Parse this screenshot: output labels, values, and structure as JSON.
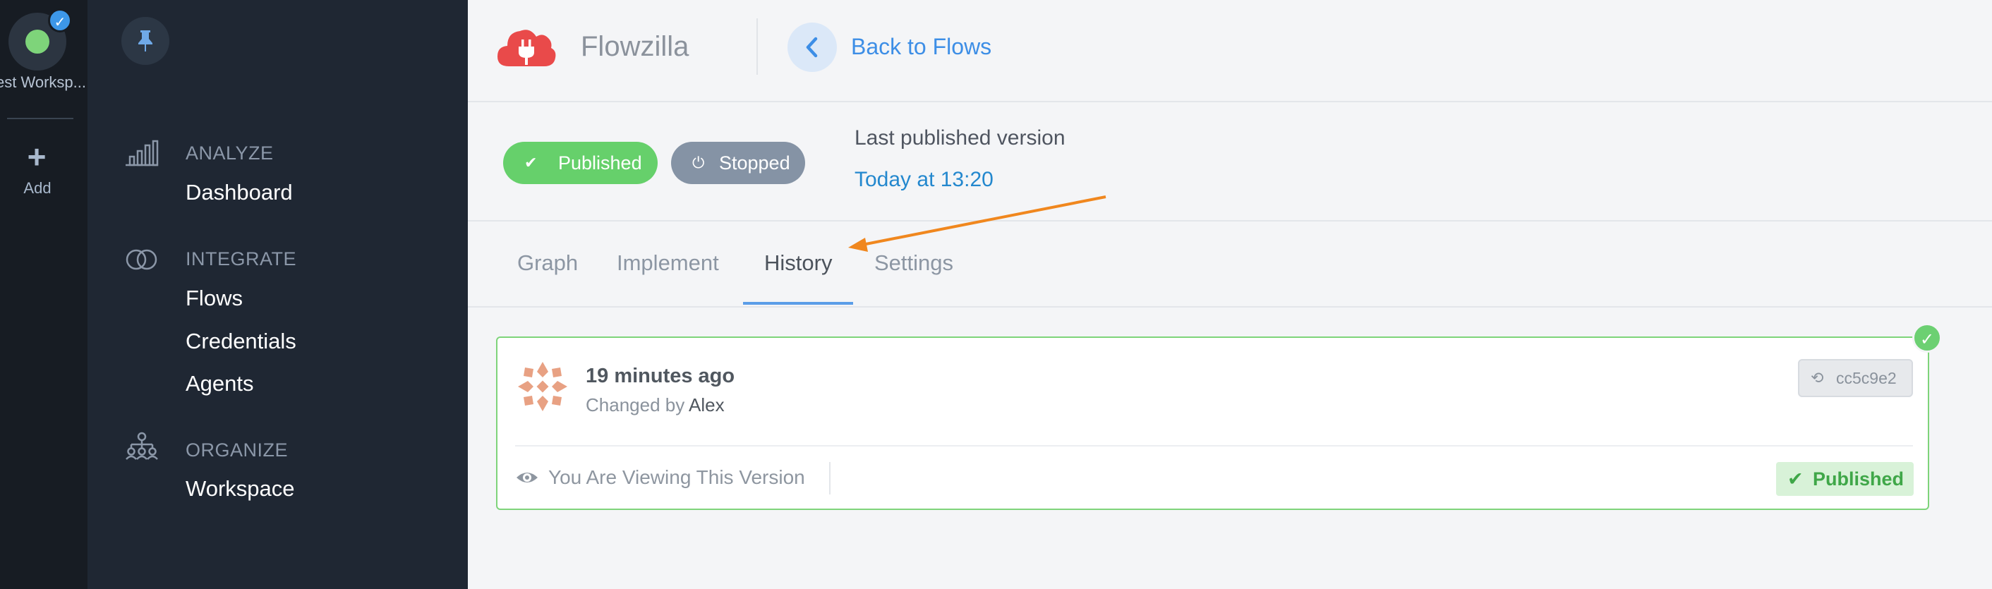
{
  "workspace": {
    "name": "est Worksp...",
    "add_label": "Add"
  },
  "nav": {
    "groups": [
      {
        "label": "ANALYZE",
        "items": [
          "Dashboard"
        ]
      },
      {
        "label": "INTEGRATE",
        "items": [
          "Flows",
          "Credentials",
          "Agents"
        ]
      },
      {
        "label": "ORGANIZE",
        "items": [
          "Workspace"
        ]
      }
    ]
  },
  "header": {
    "app_name": "Flowzilla",
    "back_label": "Back to Flows"
  },
  "status": {
    "published_label": "Published",
    "stopped_label": "Stopped",
    "last_published_label": "Last published version",
    "last_published_date": "Today at 13:20"
  },
  "tabs": [
    {
      "label": "Graph",
      "active": false
    },
    {
      "label": "Implement",
      "active": false
    },
    {
      "label": "History",
      "active": true
    },
    {
      "label": "Settings",
      "active": false
    }
  ],
  "history": {
    "time": "19 minutes ago",
    "changed_by_prefix": "Changed by",
    "author": "Alex",
    "commit": "cc5c9e2",
    "viewing_label": "You Are Viewing This Version",
    "badge": "Published"
  },
  "colors": {
    "rail_bg": "#171c23",
    "nav_bg": "#1f2733",
    "accent_blue": "#3d8ee6",
    "published_green": "#66d06b",
    "stopped_gray": "#8593a5",
    "annotation_arrow": "#f0871e"
  },
  "icons": {
    "workspace": "workspace-avatar-icon",
    "check": "check-icon",
    "add": "plus-icon",
    "pin": "pin-icon",
    "analyze": "bar-chart-icon",
    "integrate": "link-rings-icon",
    "organize": "org-chart-icon",
    "logo": "cloud-plug-logo",
    "back": "chevron-left-icon",
    "power": "power-icon",
    "history": "history-icon",
    "eye": "eye-icon"
  }
}
